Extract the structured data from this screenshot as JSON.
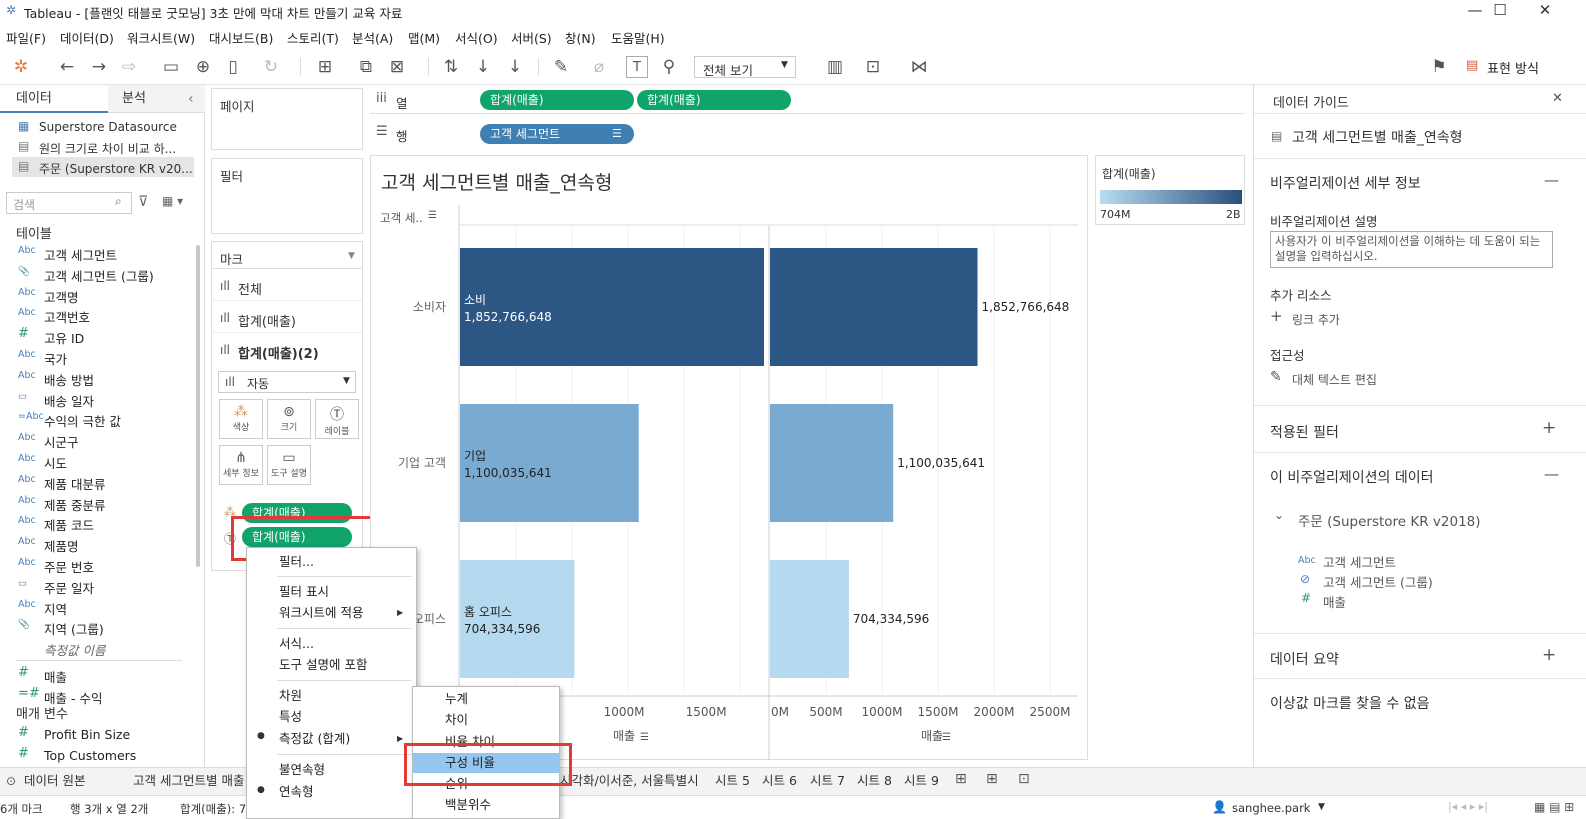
{
  "window": {
    "title": "Tableau - [플랜잇 태블로 굿모닝] 3초 만에 막대 차트 만들기 교육 자료",
    "controls": [
      "—",
      "☐",
      "✕"
    ]
  },
  "menu": [
    "파일(F)",
    "데이터(D)",
    "워크시트(W)",
    "대시보드(B)",
    "스토리(T)",
    "분석(A)",
    "맵(M)",
    "서식(O)",
    "서버(S)",
    "창(N)",
    "도움말(H)"
  ],
  "toolbar": {
    "view_select": "전체 보기",
    "show_me": "표현 방식"
  },
  "left": {
    "tabs": [
      "데이터",
      "분석"
    ],
    "datasources": [
      "Superstore Datasource",
      "원의 크기로 차이 비교 하...",
      "주문 (Superstore KR v20..."
    ],
    "search_placeholder": "검색",
    "tables_header": "테이블",
    "fields": [
      {
        "t": "Abc",
        "n": "고객 세그먼트"
      },
      {
        "t": "📎",
        "n": "고객 세그먼트 (그룹)"
      },
      {
        "t": "Abc",
        "n": "고객명"
      },
      {
        "t": "Abc",
        "n": "고객번호"
      },
      {
        "t": "#",
        "n": "고유 ID"
      },
      {
        "t": "Abc",
        "n": "국가"
      },
      {
        "t": "Abc",
        "n": "배송 방법"
      },
      {
        "t": "▭",
        "n": "배송 일자"
      },
      {
        "t": "=Abc",
        "n": "수익의 극한 값"
      },
      {
        "t": "Abc",
        "n": "시군구"
      },
      {
        "t": "Abc",
        "n": "시도"
      },
      {
        "t": "Abc",
        "n": "제품 대분류"
      },
      {
        "t": "Abc",
        "n": "제품 중분류"
      },
      {
        "t": "Abc",
        "n": "제품 코드"
      },
      {
        "t": "Abc",
        "n": "제품명"
      },
      {
        "t": "Abc",
        "n": "주문 번호"
      },
      {
        "t": "▭",
        "n": "주문 일자"
      },
      {
        "t": "Abc",
        "n": "지역"
      },
      {
        "t": "📎",
        "n": "지역 (그룹)"
      },
      {
        "t": "",
        "n": "측정값 이름"
      }
    ],
    "measures": [
      {
        "t": "#",
        "n": "매출"
      },
      {
        "t": "=#",
        "n": "매출 - 수익"
      }
    ],
    "params_header": "매개 변수",
    "params": [
      {
        "t": "#",
        "n": "Profit Bin Size"
      },
      {
        "t": "#",
        "n": "Top Customers"
      }
    ]
  },
  "shelves": {
    "pages": "페이지",
    "filters": "필터",
    "marks": "마크",
    "cols_label": "열",
    "rows_label": "행",
    "cols": [
      "합계(매출)",
      "합계(매출)"
    ],
    "rows": [
      "고객 세그먼트"
    ]
  },
  "marks": {
    "items": [
      "전체",
      "합계(매출)",
      "합계(매출)(2)"
    ],
    "type": "자동",
    "buttons": [
      "색상",
      "크기",
      "레이블",
      "세부 정보",
      "도구 설명"
    ],
    "pills": [
      "합계(매출)",
      "합계(매출)"
    ]
  },
  "sheet": {
    "title": "고객 세그먼트별 매출_연속형",
    "row_header": "고객 세..",
    "legend_title": "합계(매출)",
    "legend_min": "704M",
    "legend_max": "2B",
    "x_title": "매출"
  },
  "chart_data": {
    "type": "bar",
    "categories": [
      "소비자",
      "기업 고객",
      "홈 오피스"
    ],
    "inner_labels": [
      "소비",
      "기업",
      "홈 오피스"
    ],
    "values": [
      1852766648,
      1100035641,
      704334596
    ],
    "value_labels": [
      "1,852,766,648",
      "1,100,035,641",
      "704,334,596"
    ],
    "colors": [
      "#2c5784",
      "#79aad2",
      "#b5daf0"
    ],
    "x_ticks_left": [
      "1000M",
      "1500M"
    ],
    "x_ticks_right": [
      "0M",
      "500M",
      "1000M",
      "1500M",
      "2000M",
      "2500M"
    ],
    "xlabel": "매출",
    "xlim": [
      0,
      2750000000
    ]
  },
  "context_menu": {
    "items": [
      "필터...",
      "필터 표시",
      "워크시트에 적용",
      "서식...",
      "도구 설명에 포함",
      "차원",
      "특성",
      "측정값 (합계)",
      "불연속형",
      "연속형"
    ]
  },
  "submenu": {
    "items": [
      "누계",
      "차이",
      "비율 차이",
      "구성 비율",
      "순위",
      "백분위수"
    ],
    "highlight": "구성 비율"
  },
  "guide": {
    "title": "데이터 가이드",
    "viz_name": "고객 세그먼트별 매출_연속형",
    "detail_h": "비주얼리제이션 세부 정보",
    "desc_label": "비주얼리제이션 설명",
    "desc_ph": "사용자가 이 비주얼리제이션을 이해하는 데 도움이 되는 설명을 입력하십시오.",
    "res_label": "추가 리소스",
    "add_link": "링크 추가",
    "access": "접근성",
    "alt_text": "대체 텍스트 편집",
    "applied": "적용된 필터",
    "data_h": "이 비주얼리제이션의 데이터",
    "source": "주문 (Superstore KR v2018)",
    "fields": [
      "고객 세그먼트",
      "고객 세그먼트 (그룹)",
      "매출"
    ],
    "summary": "데이터 요약",
    "outlier": "이상값 마크를 찾을 수 없음"
  },
  "bottom": {
    "datasource": "데이터 원본",
    "tabs": [
      "고객 세그먼트별 매출",
      "시각화/이서준, 서울특별시",
      "시트 5",
      "시트 6",
      "시트 7",
      "시트 8",
      "시트 9"
    ],
    "status": "6개 마크",
    "dims": "행 3개 x 열 2개",
    "sum": "합계(매출): 7",
    "user": "sanghee.park"
  }
}
